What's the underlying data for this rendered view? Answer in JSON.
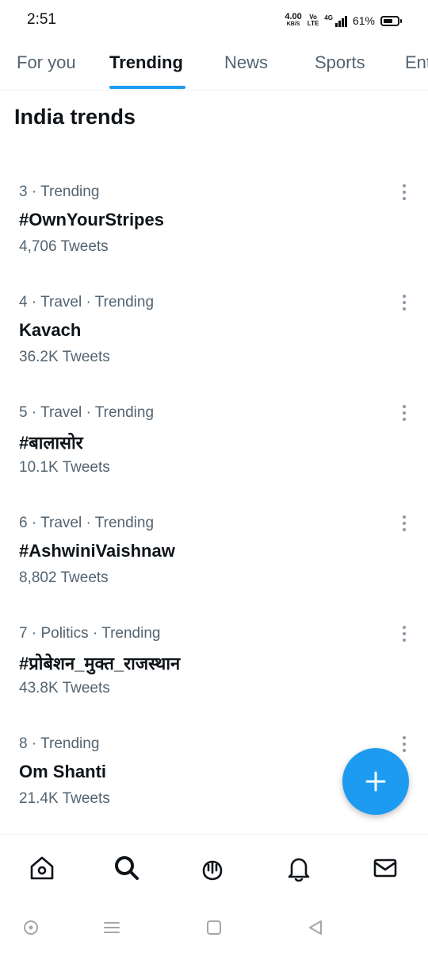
{
  "status_bar": {
    "time": "2:51",
    "net_speed": "4.00",
    "net_speed_unit": "KB/S",
    "volte_top": "Vo",
    "volte_bottom": "LTE",
    "network": "4G",
    "battery_percent": "61%"
  },
  "tabs": [
    {
      "label": "For you"
    },
    {
      "label": "Trending"
    },
    {
      "label": "News"
    },
    {
      "label": "Sports"
    },
    {
      "label": "Ent"
    }
  ],
  "active_tab": "Trending",
  "section_title": "India trends",
  "trends": [
    {
      "meta": "3 · Trending",
      "name": "#OwnYourStripes",
      "count": "4,706 Tweets"
    },
    {
      "meta": "4 · Travel · Trending",
      "name": "Kavach",
      "count": "36.2K Tweets"
    },
    {
      "meta": "5 · Travel · Trending",
      "name": "#बालासोर",
      "count": "10.1K Tweets"
    },
    {
      "meta": "6 · Travel · Trending",
      "name": "#AshwiniVaishnaw",
      "count": "8,802 Tweets"
    },
    {
      "meta": "7 · Politics · Trending",
      "name": "#प्रोबेशन_मुक्त_राजस्थान",
      "count": "43.8K Tweets"
    },
    {
      "meta": "8 · Trending",
      "name": "Om Shanti",
      "count": "21.4K Tweets"
    }
  ],
  "bottom_nav": [
    "home-icon",
    "search-icon",
    "spaces-icon",
    "bell-icon",
    "mail-icon"
  ],
  "fab_icon": "plus-icon",
  "colors": {
    "accent": "#1d9bf0",
    "text_primary": "#0f1419",
    "text_secondary": "#536471"
  }
}
